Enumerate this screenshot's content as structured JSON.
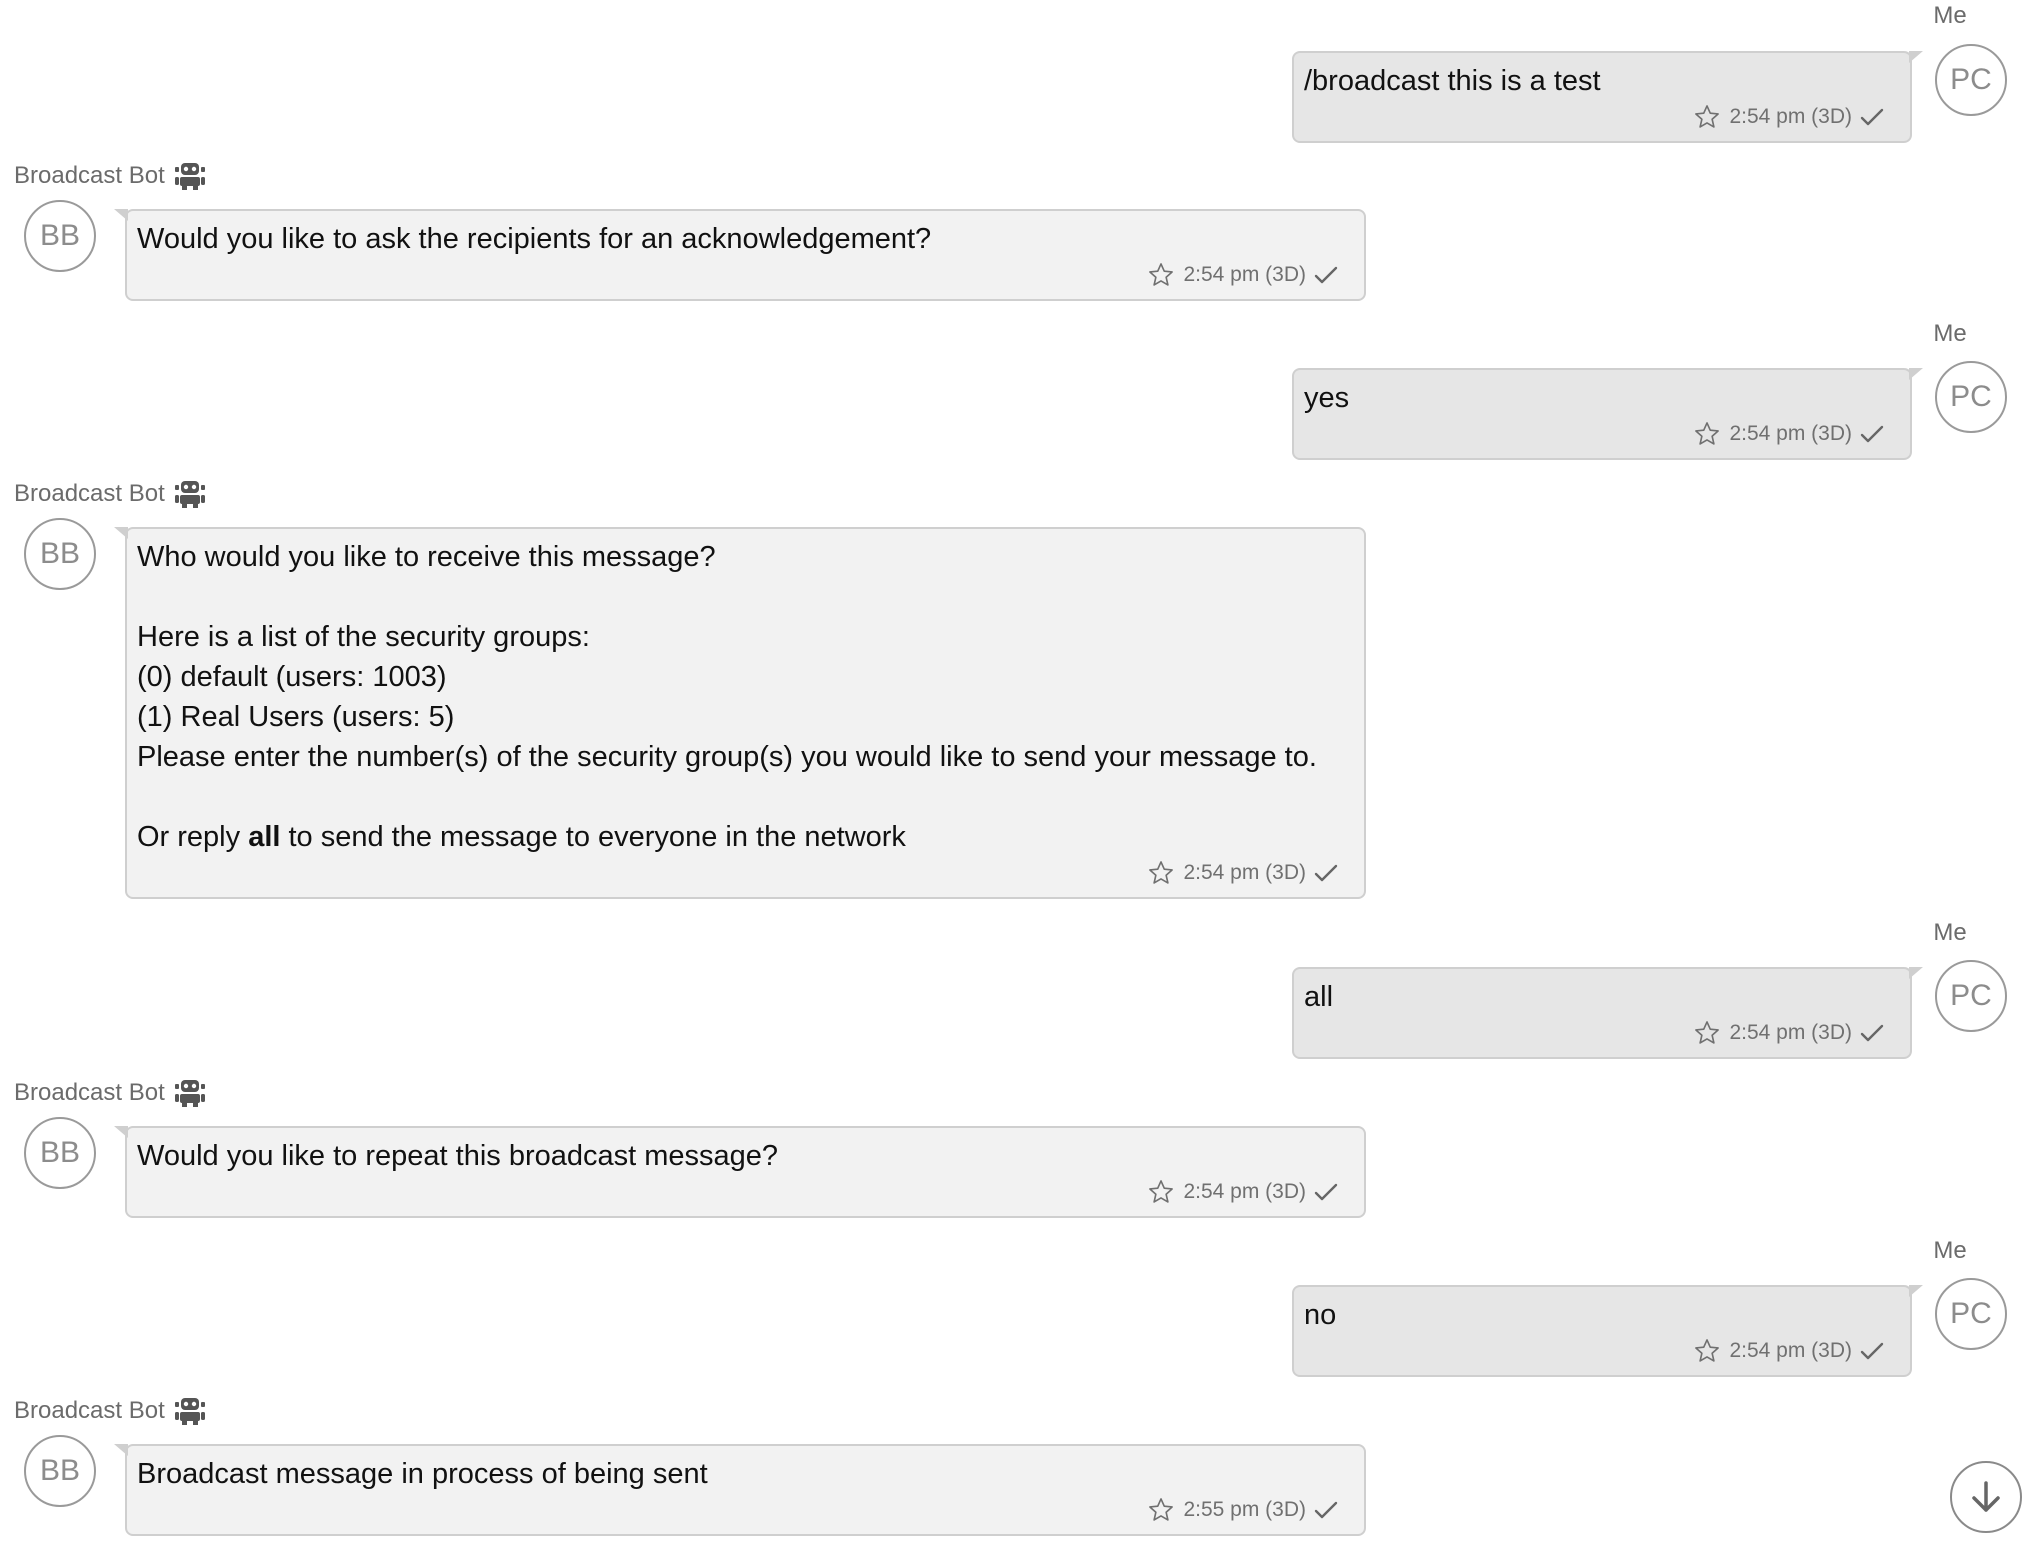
{
  "messages": [
    {
      "from": "me",
      "sender": "Me",
      "avatar": "PC",
      "lines": [
        "/broadcast this is a test"
      ],
      "time": "2:54 pm (3D)"
    },
    {
      "from": "bot",
      "sender": "Broadcast Bot",
      "avatar": "BB",
      "lines": [
        "Would you like to ask the recipients for an acknowledgement?"
      ],
      "time": "2:54 pm (3D)"
    },
    {
      "from": "me",
      "sender": "Me",
      "avatar": "PC",
      "lines": [
        "yes"
      ],
      "time": "2:54 pm (3D)"
    },
    {
      "from": "bot",
      "sender": "Broadcast Bot",
      "avatar": "BB",
      "lines": [
        "Who would you like to receive this message?",
        "",
        "Here is a list of the security groups:",
        "(0) default (users: 1003)",
        "(1) Real Users (users: 5)",
        "Please enter the number(s) of the security group(s) you would like to send your message to.",
        ""
      ],
      "reply_line": {
        "before": "Or reply ",
        "bold": "all",
        "after": " to send the message to everyone in the network"
      },
      "time": "2:54 pm (3D)"
    },
    {
      "from": "me",
      "sender": "Me",
      "avatar": "PC",
      "lines": [
        "all"
      ],
      "time": "2:54 pm (3D)"
    },
    {
      "from": "bot",
      "sender": "Broadcast Bot",
      "avatar": "BB",
      "lines": [
        "Would you like to repeat this broadcast message?"
      ],
      "time": "2:54 pm (3D)"
    },
    {
      "from": "me",
      "sender": "Me",
      "avatar": "PC",
      "lines": [
        "no"
      ],
      "time": "2:54 pm (3D)"
    },
    {
      "from": "bot",
      "sender": "Broadcast Bot",
      "avatar": "BB",
      "lines": [
        "Broadcast message in process of being sent"
      ],
      "time": "2:55 pm (3D)"
    }
  ],
  "icons": {
    "favorite": "star-icon",
    "delivered": "check-icon",
    "bot_badge": "robot-icon",
    "scroll": "arrow-down-icon"
  },
  "colors": {
    "my_bubble": "#e6e6e6",
    "bot_bubble": "#f2f2f2",
    "bubble_border": "#cfcfcf",
    "meta_text": "#707070"
  }
}
